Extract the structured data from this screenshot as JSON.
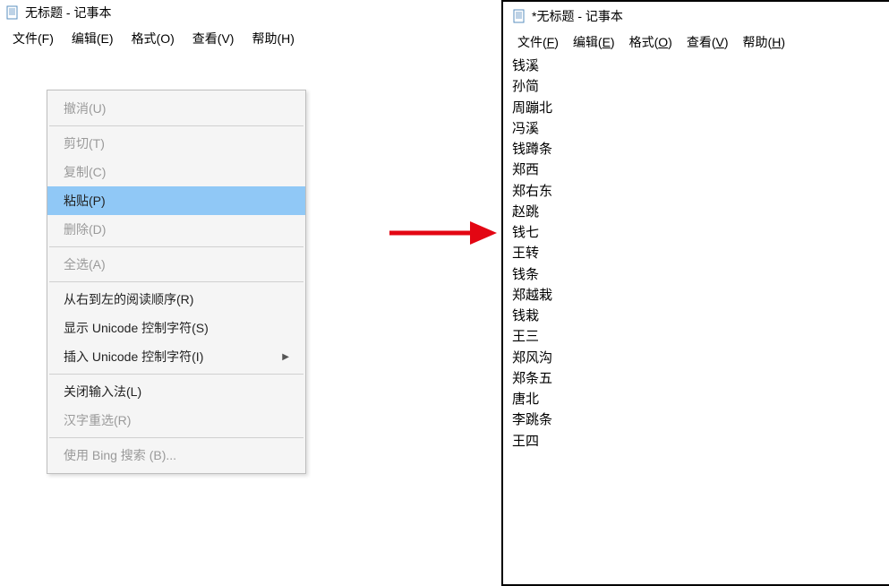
{
  "left": {
    "title": "无标题 - 记事本",
    "menubar": {
      "file": "文件(F)",
      "edit": "编辑(E)",
      "format": "格式(O)",
      "view": "查看(V)",
      "help": "帮助(H)"
    },
    "context_menu": {
      "undo": "撤消(U)",
      "cut": "剪切(T)",
      "copy": "复制(C)",
      "paste": "粘贴(P)",
      "delete": "删除(D)",
      "select_all": "全选(A)",
      "rtl": "从右到左的阅读顺序(R)",
      "show_unicode": "显示 Unicode 控制字符(S)",
      "insert_unicode": "插入 Unicode 控制字符(I)",
      "close_ime": "关闭输入法(L)",
      "reconvert": "汉字重选(R)",
      "bing_search": "使用 Bing 搜索 (B)..."
    }
  },
  "right": {
    "title": "*无标题 - 记事本",
    "menubar": {
      "file_pre": "文件(",
      "file_u": "F",
      "file_post": ")",
      "edit_pre": "编辑(",
      "edit_u": "E",
      "edit_post": ")",
      "format_pre": "格式(",
      "format_u": "O",
      "format_post": ")",
      "view_pre": "查看(",
      "view_u": "V",
      "view_post": ")",
      "help_pre": "帮助(",
      "help_u": "H",
      "help_post": ")"
    },
    "lines": [
      "钱溪",
      "孙简",
      "周蹦北",
      "冯溪",
      "钱蹲条",
      "郑西",
      "郑右东",
      "赵跳",
      "钱七",
      "王转",
      "钱条",
      "郑越栽",
      "钱栽",
      "王三",
      "郑风沟",
      "郑条五",
      "唐北",
      "李跳条",
      "王四"
    ]
  }
}
